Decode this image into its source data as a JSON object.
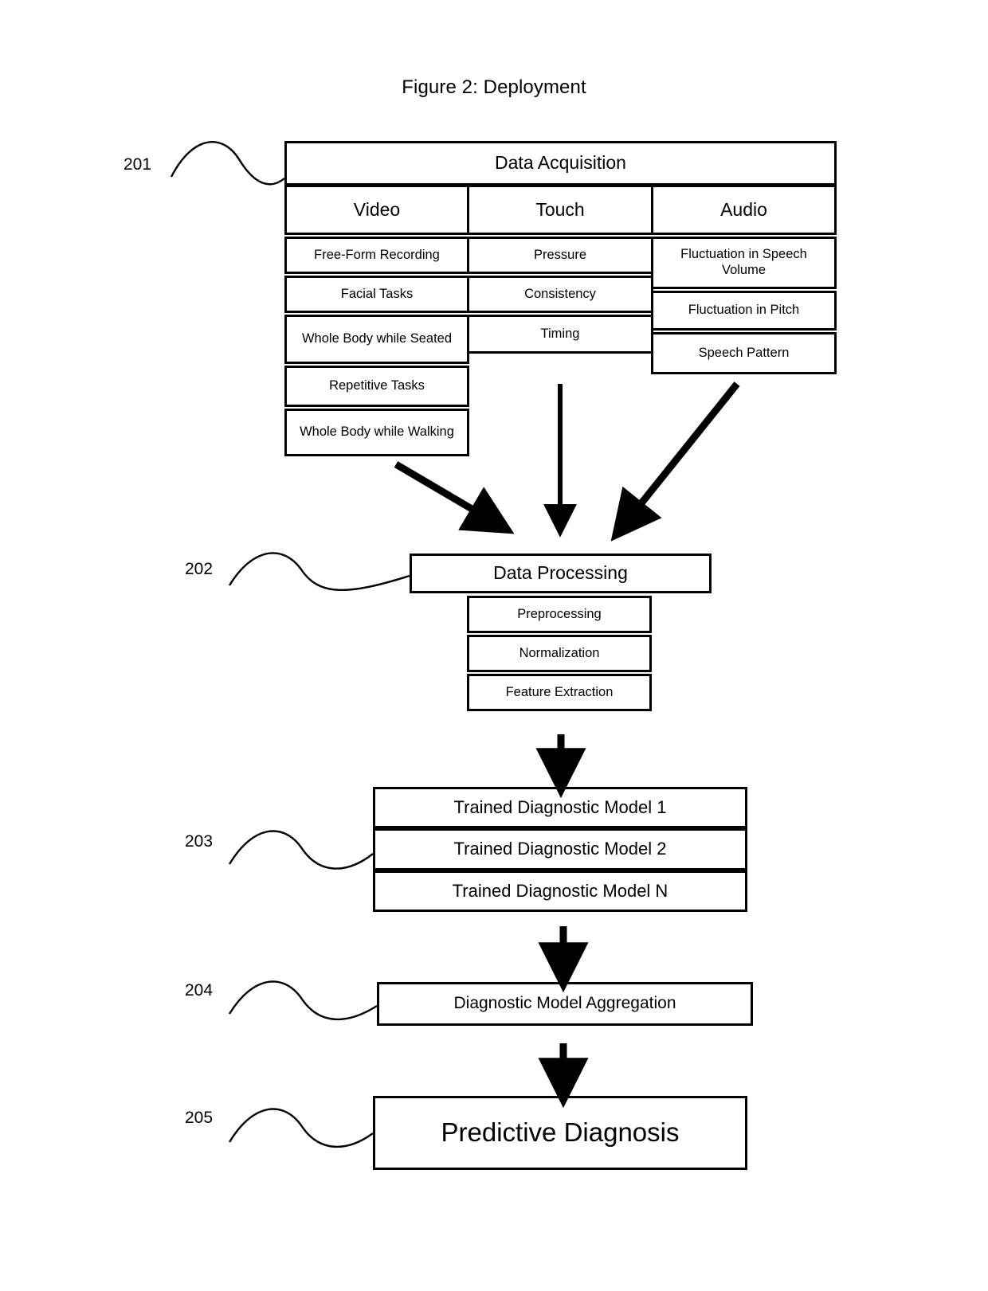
{
  "figure": {
    "title": "Figure 2: Deployment"
  },
  "refs": {
    "acquisition": "201",
    "processing": "202",
    "models": "203",
    "aggregation": "204",
    "diagnosis": "205"
  },
  "acquisition": {
    "header": "Data Acquisition",
    "columns": [
      {
        "name": "Video",
        "items": [
          "Free-Form Recording",
          "Facial Tasks",
          "Whole Body while Seated",
          "Repetitive Tasks",
          "Whole Body while Walking"
        ]
      },
      {
        "name": "Touch",
        "items": [
          "Pressure",
          "Consistency",
          "Timing"
        ]
      },
      {
        "name": "Audio",
        "items": [
          "Fluctuation in Speech Volume",
          "Fluctuation in Pitch",
          "Speech Pattern"
        ]
      }
    ]
  },
  "processing": {
    "header": "Data Processing",
    "steps": [
      "Preprocessing",
      "Normalization",
      "Feature Extraction"
    ]
  },
  "models": {
    "items": [
      "Trained Diagnostic Model 1",
      "Trained Diagnostic Model 2",
      "Trained Diagnostic Model N"
    ]
  },
  "aggregation": {
    "label": "Diagnostic Model Aggregation"
  },
  "diagnosis": {
    "label": "Predictive Diagnosis"
  },
  "style": {
    "stroke": "#000000",
    "background": "#ffffff"
  }
}
